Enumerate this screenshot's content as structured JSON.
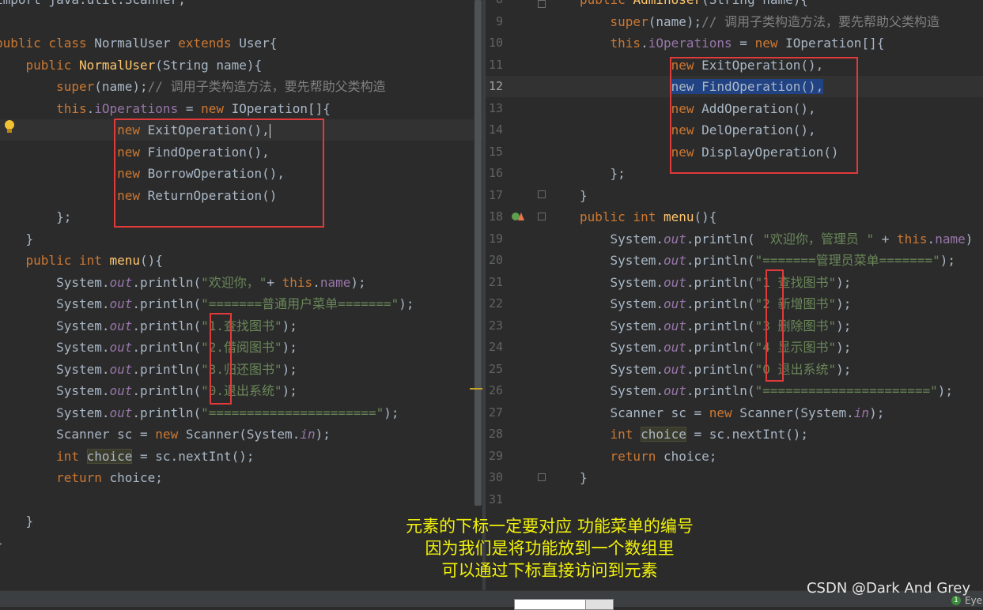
{
  "left_editor": {
    "lines": [
      {
        "tokens": [
          {
            "t": "import java.util.Scanner;",
            "c": "def"
          }
        ]
      },
      {
        "tokens": []
      },
      {
        "tokens": [
          {
            "t": "public class ",
            "c": "kw"
          },
          {
            "t": "NormalUser ",
            "c": "def"
          },
          {
            "t": "extends ",
            "c": "kw"
          },
          {
            "t": "User{",
            "c": "def"
          }
        ]
      },
      {
        "tokens": [
          {
            "t": "    public ",
            "c": "kw"
          },
          {
            "t": "NormalUser",
            "c": "fn"
          },
          {
            "t": "(String name){",
            "c": "def"
          }
        ]
      },
      {
        "tokens": [
          {
            "t": "        super",
            "c": "kw"
          },
          {
            "t": "(name);",
            "c": "def"
          },
          {
            "t": "// 调用子类构造方法，要先帮助父类构造",
            "c": "cm"
          }
        ]
      },
      {
        "tokens": [
          {
            "t": "        this",
            "c": "kw"
          },
          {
            "t": ".",
            "c": "def"
          },
          {
            "t": "iOperations",
            "c": "fld"
          },
          {
            "t": " = ",
            "c": "def"
          },
          {
            "t": "new ",
            "c": "kw"
          },
          {
            "t": "IOperation[]{",
            "c": "def"
          }
        ]
      },
      {
        "tokens": [
          {
            "t": "                new ",
            "c": "kw"
          },
          {
            "t": "ExitOperation(),",
            "c": "def"
          }
        ]
      },
      {
        "tokens": [
          {
            "t": "                new ",
            "c": "kw"
          },
          {
            "t": "FindOperation(),",
            "c": "def"
          }
        ]
      },
      {
        "tokens": [
          {
            "t": "                new ",
            "c": "kw"
          },
          {
            "t": "BorrowOperation(),",
            "c": "def"
          }
        ]
      },
      {
        "tokens": [
          {
            "t": "                new ",
            "c": "kw"
          },
          {
            "t": "ReturnOperation()",
            "c": "def"
          }
        ]
      },
      {
        "tokens": [
          {
            "t": "        };",
            "c": "def"
          }
        ]
      },
      {
        "tokens": [
          {
            "t": "    }",
            "c": "def"
          }
        ]
      },
      {
        "tokens": [
          {
            "t": "    public int ",
            "c": "kw"
          },
          {
            "t": "menu",
            "c": "fn"
          },
          {
            "t": "(){",
            "c": "def"
          }
        ]
      },
      {
        "tokens": [
          {
            "t": "        System.",
            "c": "def"
          },
          {
            "t": "out",
            "c": "it"
          },
          {
            "t": ".println(",
            "c": "def"
          },
          {
            "t": "\"欢迎你，\"",
            "c": "str"
          },
          {
            "t": "+ ",
            "c": "def"
          },
          {
            "t": "this",
            "c": "kw"
          },
          {
            "t": ".",
            "c": "def"
          },
          {
            "t": "name",
            "c": "fld"
          },
          {
            "t": ");",
            "c": "def"
          }
        ]
      },
      {
        "tokens": [
          {
            "t": "        System.",
            "c": "def"
          },
          {
            "t": "out",
            "c": "it"
          },
          {
            "t": ".println(",
            "c": "def"
          },
          {
            "t": "\"=======普通用户菜单=======\"",
            "c": "str"
          },
          {
            "t": ");",
            "c": "def"
          }
        ]
      },
      {
        "tokens": [
          {
            "t": "        System.",
            "c": "def"
          },
          {
            "t": "out",
            "c": "it"
          },
          {
            "t": ".println(",
            "c": "def"
          },
          {
            "t": "\"1.查找图书\"",
            "c": "str"
          },
          {
            "t": ");",
            "c": "def"
          }
        ]
      },
      {
        "tokens": [
          {
            "t": "        System.",
            "c": "def"
          },
          {
            "t": "out",
            "c": "it"
          },
          {
            "t": ".println(",
            "c": "def"
          },
          {
            "t": "\"2.借阅图书\"",
            "c": "str"
          },
          {
            "t": ");",
            "c": "def"
          }
        ]
      },
      {
        "tokens": [
          {
            "t": "        System.",
            "c": "def"
          },
          {
            "t": "out",
            "c": "it"
          },
          {
            "t": ".println(",
            "c": "def"
          },
          {
            "t": "\"3.归还图书\"",
            "c": "str"
          },
          {
            "t": ");",
            "c": "def"
          }
        ]
      },
      {
        "tokens": [
          {
            "t": "        System.",
            "c": "def"
          },
          {
            "t": "out",
            "c": "it"
          },
          {
            "t": ".println(",
            "c": "def"
          },
          {
            "t": "\"0.退出系统\"",
            "c": "str"
          },
          {
            "t": ");",
            "c": "def"
          }
        ]
      },
      {
        "tokens": [
          {
            "t": "        System.",
            "c": "def"
          },
          {
            "t": "out",
            "c": "it"
          },
          {
            "t": ".println(",
            "c": "def"
          },
          {
            "t": "\"======================\"",
            "c": "str"
          },
          {
            "t": ");",
            "c": "def"
          }
        ]
      },
      {
        "tokens": [
          {
            "t": "        Scanner sc = ",
            "c": "def"
          },
          {
            "t": "new ",
            "c": "kw"
          },
          {
            "t": "Scanner(System.",
            "c": "def"
          },
          {
            "t": "in",
            "c": "it"
          },
          {
            "t": ");",
            "c": "def"
          }
        ]
      },
      {
        "tokens": [
          {
            "t": "        int ",
            "c": "kw"
          },
          {
            "t": "choice",
            "c": "hlv"
          },
          {
            "t": " = sc.nextInt();",
            "c": "def"
          }
        ]
      },
      {
        "tokens": [
          {
            "t": "        return ",
            "c": "kw"
          },
          {
            "t": "choice;",
            "c": "def"
          }
        ]
      },
      {
        "tokens": []
      },
      {
        "tokens": [
          {
            "t": "    }",
            "c": "def"
          }
        ]
      },
      {
        "tokens": [
          {
            "t": "}",
            "c": "def"
          }
        ]
      }
    ]
  },
  "right_editor": {
    "lines": [
      {
        "n": "8",
        "tokens": [
          {
            "t": "public ",
            "c": "kw"
          },
          {
            "t": "AdminUser",
            "c": "fn"
          },
          {
            "t": "(String name){",
            "c": "def"
          }
        ]
      },
      {
        "n": "9",
        "tokens": [
          {
            "t": "    super",
            "c": "kw"
          },
          {
            "t": "(name);",
            "c": "def"
          },
          {
            "t": "// 调用子类构造方法，要先帮助父类构造",
            "c": "cm"
          }
        ]
      },
      {
        "n": "10",
        "tokens": [
          {
            "t": "    this",
            "c": "kw"
          },
          {
            "t": ".",
            "c": "def"
          },
          {
            "t": "iOperations",
            "c": "fld"
          },
          {
            "t": " = ",
            "c": "def"
          },
          {
            "t": "new ",
            "c": "kw"
          },
          {
            "t": "IOperation[]{",
            "c": "def"
          }
        ]
      },
      {
        "n": "11",
        "tokens": [
          {
            "t": "            new ",
            "c": "kw"
          },
          {
            "t": "ExitOperation(),",
            "c": "def"
          }
        ]
      },
      {
        "n": "12",
        "tokens": [
          {
            "t": "            ",
            "c": "def"
          },
          {
            "t": "new FindOperation(),",
            "c": "sel"
          }
        ]
      },
      {
        "n": "13",
        "tokens": [
          {
            "t": "            new ",
            "c": "kw"
          },
          {
            "t": "AddOperation(),",
            "c": "def"
          }
        ]
      },
      {
        "n": "14",
        "tokens": [
          {
            "t": "            new ",
            "c": "kw"
          },
          {
            "t": "DelOperation(),",
            "c": "def"
          }
        ]
      },
      {
        "n": "15",
        "tokens": [
          {
            "t": "            new ",
            "c": "kw"
          },
          {
            "t": "DisplayOperation()",
            "c": "def"
          }
        ]
      },
      {
        "n": "16",
        "tokens": [
          {
            "t": "    };",
            "c": "def"
          }
        ]
      },
      {
        "n": "17",
        "tokens": [
          {
            "t": "}",
            "c": "def"
          }
        ]
      },
      {
        "n": "18",
        "tokens": [
          {
            "t": "public int ",
            "c": "kw"
          },
          {
            "t": "menu",
            "c": "fn"
          },
          {
            "t": "(){",
            "c": "def"
          }
        ]
      },
      {
        "n": "19",
        "tokens": [
          {
            "t": "    System.",
            "c": "def"
          },
          {
            "t": "out",
            "c": "it"
          },
          {
            "t": ".println( ",
            "c": "def"
          },
          {
            "t": "\"欢迎你，管理员 \"",
            "c": "str"
          },
          {
            "t": " + ",
            "c": "def"
          },
          {
            "t": "this",
            "c": "kw"
          },
          {
            "t": ".",
            "c": "def"
          },
          {
            "t": "name",
            "c": "fld"
          },
          {
            "t": ")",
            "c": "def"
          }
        ]
      },
      {
        "n": "20",
        "tokens": [
          {
            "t": "    System.",
            "c": "def"
          },
          {
            "t": "out",
            "c": "it"
          },
          {
            "t": ".println(",
            "c": "def"
          },
          {
            "t": "\"=======管理员菜单=======\"",
            "c": "str"
          },
          {
            "t": ");",
            "c": "def"
          }
        ]
      },
      {
        "n": "21",
        "tokens": [
          {
            "t": "    System.",
            "c": "def"
          },
          {
            "t": "out",
            "c": "it"
          },
          {
            "t": ".println(",
            "c": "def"
          },
          {
            "t": "\"1 查找图书\"",
            "c": "str"
          },
          {
            "t": ");",
            "c": "def"
          }
        ]
      },
      {
        "n": "22",
        "tokens": [
          {
            "t": "    System.",
            "c": "def"
          },
          {
            "t": "out",
            "c": "it"
          },
          {
            "t": ".println(",
            "c": "def"
          },
          {
            "t": "\"2 新增图书\"",
            "c": "str"
          },
          {
            "t": ");",
            "c": "def"
          }
        ]
      },
      {
        "n": "23",
        "tokens": [
          {
            "t": "    System.",
            "c": "def"
          },
          {
            "t": "out",
            "c": "it"
          },
          {
            "t": ".println(",
            "c": "def"
          },
          {
            "t": "\"3 删除图书\"",
            "c": "str"
          },
          {
            "t": ");",
            "c": "def"
          }
        ]
      },
      {
        "n": "24",
        "tokens": [
          {
            "t": "    System.",
            "c": "def"
          },
          {
            "t": "out",
            "c": "it"
          },
          {
            "t": ".println(",
            "c": "def"
          },
          {
            "t": "\"4 显示图书\"",
            "c": "str"
          },
          {
            "t": ");",
            "c": "def"
          }
        ]
      },
      {
        "n": "25",
        "tokens": [
          {
            "t": "    System.",
            "c": "def"
          },
          {
            "t": "out",
            "c": "it"
          },
          {
            "t": ".println(",
            "c": "def"
          },
          {
            "t": "\"0 退出系统\"",
            "c": "str"
          },
          {
            "t": ");",
            "c": "def"
          }
        ]
      },
      {
        "n": "26",
        "tokens": [
          {
            "t": "    System.",
            "c": "def"
          },
          {
            "t": "out",
            "c": "it"
          },
          {
            "t": ".println(",
            "c": "def"
          },
          {
            "t": "\"======================\"",
            "c": "str"
          },
          {
            "t": ");",
            "c": "def"
          }
        ]
      },
      {
        "n": "27",
        "tokens": [
          {
            "t": "    Scanner sc = ",
            "c": "def"
          },
          {
            "t": "new ",
            "c": "kw"
          },
          {
            "t": "Scanner(System.",
            "c": "def"
          },
          {
            "t": "in",
            "c": "it"
          },
          {
            "t": ");",
            "c": "def"
          }
        ]
      },
      {
        "n": "28",
        "tokens": [
          {
            "t": "    int ",
            "c": "kw"
          },
          {
            "t": "choice",
            "c": "hlv"
          },
          {
            "t": " = sc.nextInt();",
            "c": "def"
          }
        ]
      },
      {
        "n": "29",
        "tokens": [
          {
            "t": "    return ",
            "c": "kw"
          },
          {
            "t": "choice;",
            "c": "def"
          }
        ]
      },
      {
        "n": "30",
        "tokens": [
          {
            "t": "}",
            "c": "def"
          }
        ]
      },
      {
        "n": "31",
        "tokens": []
      }
    ]
  },
  "annotation": {
    "line1": "元素的下标一定要对应 功能菜单的编号",
    "line2": "因为我们是将功能放到一个数组里",
    "line3": "可以通过下标直接访问到元素"
  },
  "watermark": "CSDN @Dark And Grey",
  "status": {
    "badge": "1",
    "label": "Eye"
  },
  "colors": {
    "background": "#2b2b2b",
    "keyword": "#cc7832",
    "string": "#6a8759",
    "field": "#9876aa",
    "method": "#ffc66d",
    "highlight_box": "#e23a3a",
    "annotation": "#f2f20a"
  }
}
